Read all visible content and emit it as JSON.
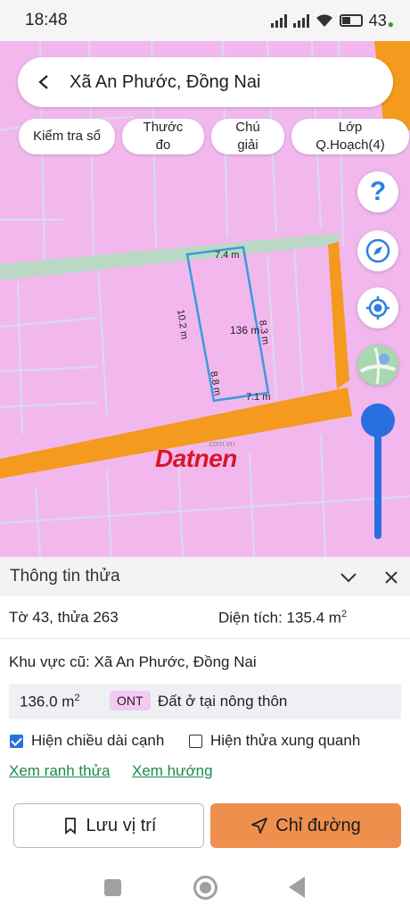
{
  "status_bar": {
    "time": "18:48",
    "battery": "43"
  },
  "search": {
    "title": "Xã An Phước, Đồng Nai"
  },
  "chips": [
    {
      "label": "Kiểm tra sổ"
    },
    {
      "label": "Thước đo"
    },
    {
      "label": "Chú giải"
    },
    {
      "label": "Lớp Q.Hoạch(4)"
    }
  ],
  "controls": {
    "help": "?"
  },
  "map": {
    "colors": {
      "zone": "#f2b8ee",
      "road": "#f39a1f",
      "boundary": "#3a9ae0",
      "lot_lines": "#cfd7e8"
    },
    "plot": {
      "top_edge": "7.4 m",
      "left_edge": "10.2 m",
      "area": "136 m",
      "right_edge": "8.3 m",
      "bottom_left": "8.8 m",
      "bottom_edge": "7.1 m"
    },
    "watermark": {
      "brand": "Datnen",
      "domain": ".com.vn"
    }
  },
  "sheet": {
    "title": "Thông tin thửa",
    "parcel": "Tờ 43, thửa 263",
    "area_label": "Diện tích: 135.4 m",
    "area_unit_sup": "2",
    "old_region": "Khu vực cũ: Xã An Phước, Đồng Nai",
    "land": {
      "area": "136.0 m",
      "area_sup": "2",
      "code": "ONT",
      "desc": "Đất ở tại nông thôn"
    },
    "check_edges": {
      "label": "Hiện chiều dài cạnh",
      "checked": true
    },
    "check_neighbors": {
      "label": "Hiện thửa xung quanh",
      "checked": false
    },
    "link_boundary": "Xem ranh thửa",
    "link_direction": "Xem hướng",
    "save_button": "Lưu vị trí",
    "route_button": "Chỉ đường"
  }
}
